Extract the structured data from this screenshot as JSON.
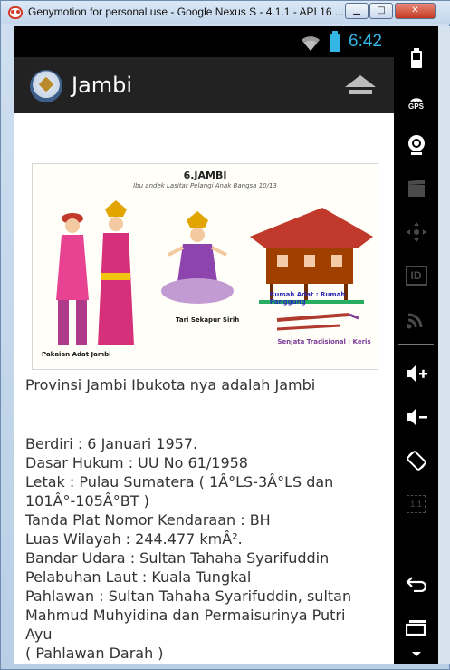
{
  "window": {
    "title": "Genymotion for personal use - Google Nexus S - 4.1.1 - API 16 ...",
    "minimize_glyph": "▁",
    "maximize_glyph": "□",
    "close_glyph": "✕"
  },
  "statusbar": {
    "time": "6:42",
    "accent_color": "#33b5e5"
  },
  "actionbar": {
    "title": "Jambi",
    "home_icon": "home-icon"
  },
  "hero_image": {
    "title": "6.JAMBI",
    "subtitle": "Ibu andek Lasitar Pelangi Anak Bangsa 10/13",
    "captions": {
      "pakaian": "Pakaian Adat Jambi",
      "tari": "Tari Sekapur Sirih",
      "rumah": "Rumah Adat : Rumah Panggung",
      "senjata": "Senjata Tradisional : Keris"
    }
  },
  "content": {
    "intro": "Provinsi Jambi Ibukota nya adalah Jambi",
    "details": [
      "Berdiri : 6 Januari 1957.",
      "Dasar Hukum : UU No 61/1958",
      "Letak : Pulau Sumatera ( 1Â°LS-3Â°LS dan",
      "101Â°-105Â°BT )",
      "Tanda Plat Nomor Kendaraan : BH",
      "Luas Wilayah : 244.477 kmÂ².",
      "Bandar Udara : Sultan Tahaha Syarifuddin",
      "Pelabuhan Laut : Kuala Tungkal",
      "Pahlawan : Sultan Tahaha Syarifuddin, sultan",
      "Mahmud Muhyidina dan Permaisurinya Putri",
      "Ayu",
      "( Pahlawan Darah )"
    ]
  },
  "side_panel": {
    "buttons": [
      {
        "name": "battery-icon"
      },
      {
        "name": "gps-icon",
        "label": "GPS"
      },
      {
        "name": "camera-icon"
      },
      {
        "name": "video-capture-icon"
      },
      {
        "name": "dpad-icon"
      },
      {
        "name": "id-icon",
        "label": "ID"
      },
      {
        "name": "cast-icon"
      },
      {
        "name": "volume-up-icon"
      },
      {
        "name": "volume-down-icon"
      },
      {
        "name": "rotate-icon"
      },
      {
        "name": "pixel-perfect-icon",
        "label": "1:1"
      },
      {
        "name": "back-icon"
      },
      {
        "name": "recent-apps-icon"
      },
      {
        "name": "menu-icon"
      }
    ]
  }
}
